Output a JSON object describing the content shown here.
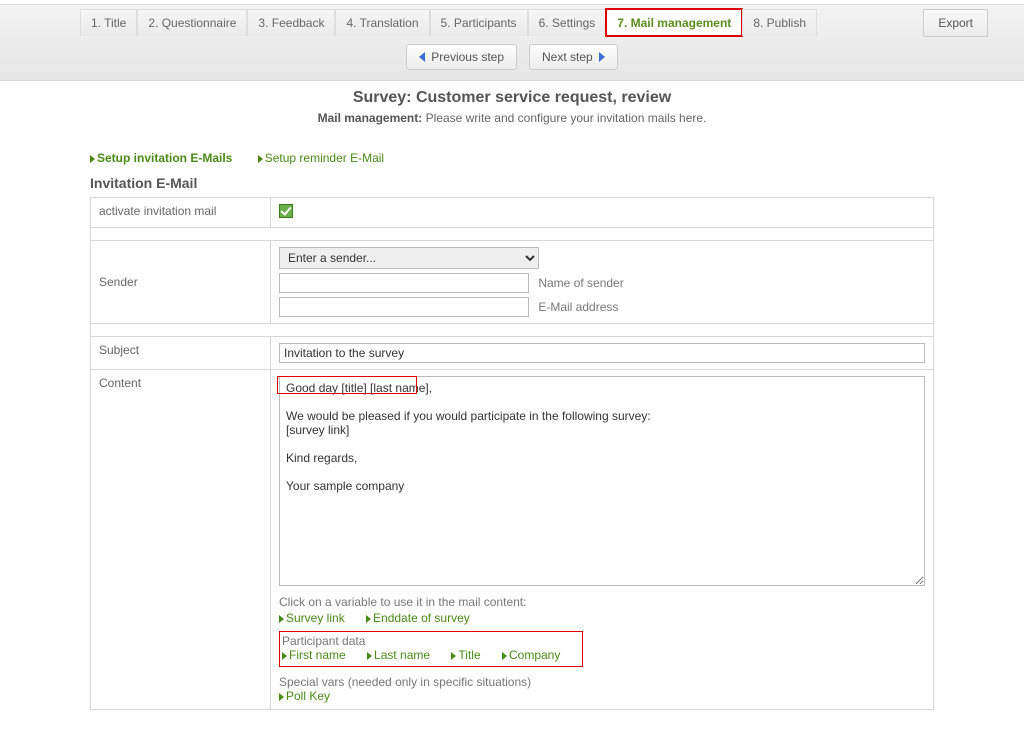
{
  "wizard": {
    "steps": [
      "1. Title",
      "2. Questionnaire",
      "3. Feedback",
      "4. Translation",
      "5. Participants",
      "6. Settings",
      "7. Mail management",
      "8. Publish"
    ],
    "active_index": 6,
    "export": "Export",
    "prev": "Previous step",
    "next": "Next step"
  },
  "header": {
    "title": "Survey: Customer service request, review",
    "sub_b": "Mail management:",
    "sub_rest": " Please write and configure your invitation mails here."
  },
  "tabs": {
    "invitation": "Setup invitation E-Mails",
    "reminder": "Setup reminder E-Mail"
  },
  "section_title": "Invitation E-Mail",
  "rows": {
    "activate_label": "activate invitation mail",
    "sender_label": "Sender",
    "sender_placeholder": "Enter a sender...",
    "name_of_sender": "Name of sender",
    "email_address": "E-Mail address",
    "subject_label": "Subject",
    "subject_value": "Invitation to the survey",
    "content_label": "Content",
    "content_value": "Good day [title] [last name],\n\nWe would be pleased if you would participate in the following survey:\n[survey link]\n\nKind regards,\n\nYour sample company"
  },
  "hints": {
    "click_var": "Click on a variable to use it in the mail content:",
    "vars_main": [
      "Survey link",
      "Enddate of survey"
    ],
    "participant_title": "Participant data",
    "participant_vars": [
      "First name",
      "Last name",
      "Title",
      "Company"
    ],
    "special_title": "Special vars (needed only in specific situations)",
    "special_vars": [
      "Poll Key"
    ]
  }
}
